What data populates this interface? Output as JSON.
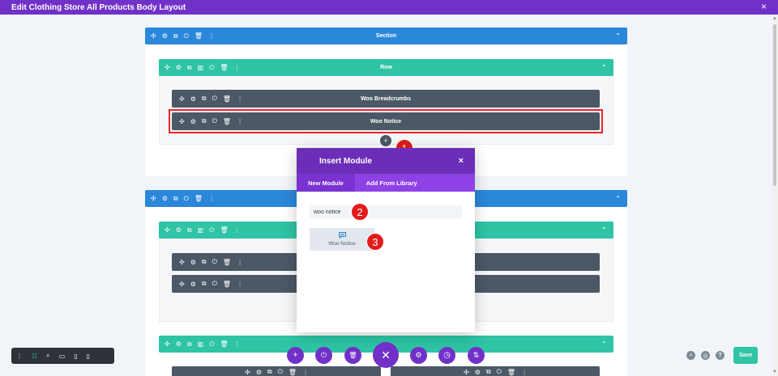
{
  "topbar": {
    "title": "Edit Clothing Store All Products Body Layout",
    "close_icon": "×"
  },
  "icons": {
    "move": "✣",
    "gear": "⚙",
    "duplicate": "⧉",
    "power": "⏻",
    "trash": "🗑",
    "more": "⋮",
    "columns": "▥",
    "chevron_up": "⌃"
  },
  "section1": {
    "label": "Section",
    "row": {
      "label": "Row",
      "modules": [
        {
          "label": "Woo Breadcrumbs"
        },
        {
          "label": "Woo Notice"
        }
      ]
    }
  },
  "section2": {
    "label": ""
  },
  "row3": {
    "label": ""
  },
  "badges": [
    "1",
    "2",
    "3"
  ],
  "modal": {
    "title": "Insert Module",
    "close": "×",
    "tabs": [
      {
        "label": "New Module",
        "active": true
      },
      {
        "label": "Add From Library",
        "active": false
      }
    ],
    "search_value": "woo notice",
    "result": {
      "label": "Woo Notice",
      "icon": "comment-icon"
    }
  },
  "bottom_toolbar": {
    "add": "+",
    "power": "⏻",
    "trash": "🗑",
    "close": "✕",
    "settings": "⚙",
    "history": "◷",
    "sort": "⇅"
  },
  "right_tools": {
    "zoom": "⌕",
    "layers": "◎",
    "help": "?"
  },
  "save_label": "Save",
  "colors": {
    "purple": "#7131c9",
    "section_blue": "#2b87da",
    "row_teal": "#2ec4a5",
    "module_dark": "#4c5866",
    "highlight_red": "#e8252a"
  }
}
